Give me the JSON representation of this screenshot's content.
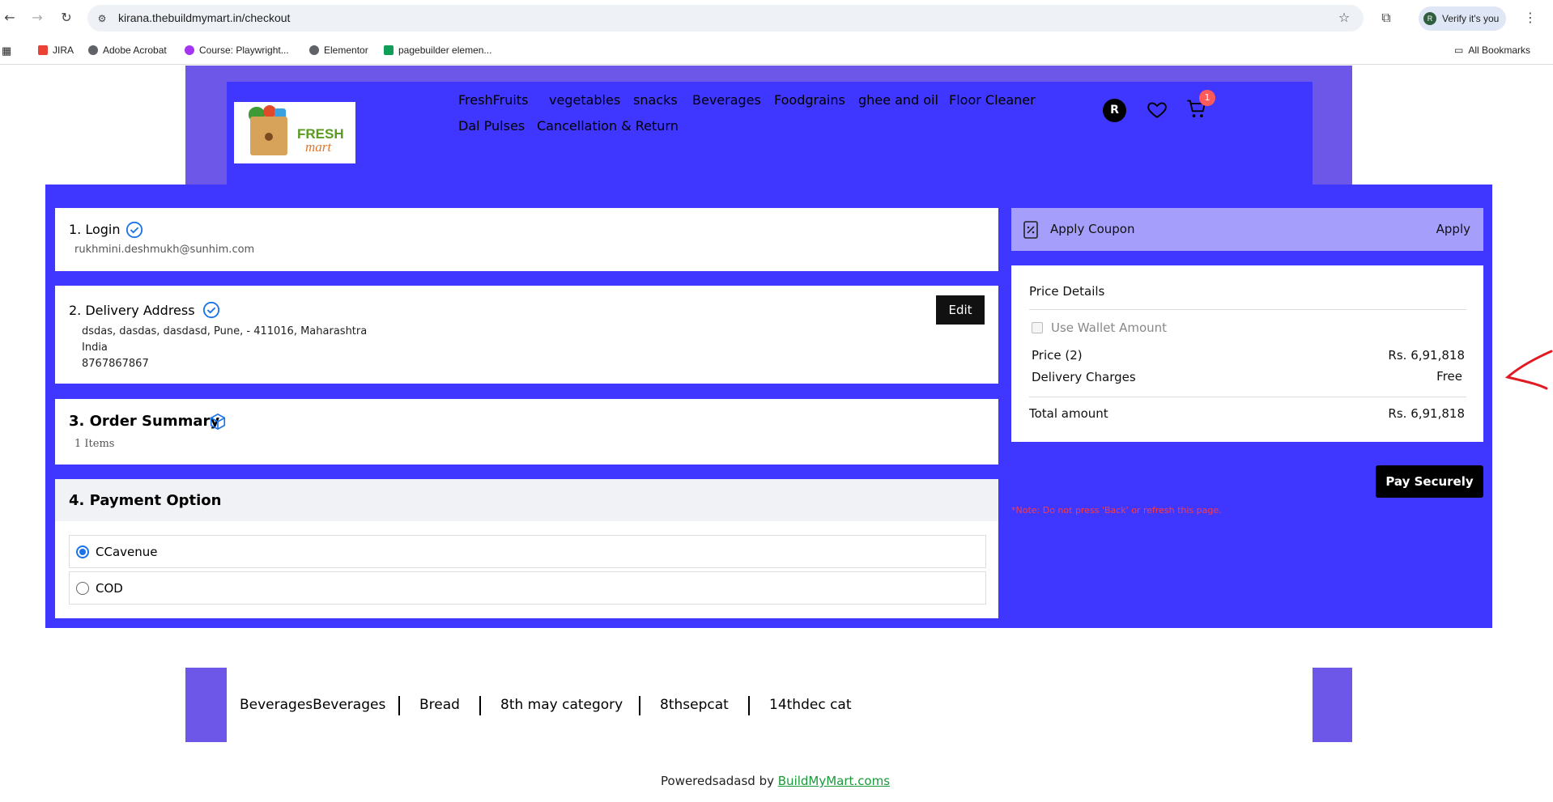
{
  "browser": {
    "url": "kirana.thebuildmymart.in/checkout",
    "profile_initial": "R",
    "verify_label": "Verify it's you",
    "bookmarks": [
      "JIRA",
      "Adobe Acrobat",
      "Course: Playwright...",
      "Elementor",
      "pagebuilder elemen..."
    ],
    "all_bookmarks": "All Bookmarks"
  },
  "header": {
    "logo_word1": "FRESH",
    "logo_word2": "mart",
    "menu": [
      "FreshFruits",
      "vegetables",
      "snacks",
      "Beverages",
      "Foodgrains",
      "ghee and oil",
      "Floor Cleaner",
      "Dal Pulses",
      "Cancellation & Return"
    ],
    "account_initial": "R",
    "cart_count": "1"
  },
  "checkout": {
    "login": {
      "title": "1. Login",
      "email": "rukhmini.deshmukh@sunhim.com"
    },
    "delivery": {
      "title": "2. Delivery Address",
      "line1": "dsdas, dasdas, dasdasd, Pune, - 411016, Maharashtra",
      "line2": "India",
      "phone": "8767867867",
      "edit_label": "Edit"
    },
    "summary": {
      "title": "3. Order Summary",
      "items": "1 Items"
    },
    "payment": {
      "title": "4. Payment Option",
      "options": [
        {
          "label": "CCavenue",
          "selected": true
        },
        {
          "label": "COD",
          "selected": false
        }
      ]
    }
  },
  "sidebar": {
    "coupon_label": "Apply Coupon",
    "apply_label": "Apply",
    "price_details_title": "Price Details",
    "wallet_label": "Use Wallet Amount",
    "price_label": "Price (2)",
    "price_value": "Rs. 6,91,818",
    "delivery_label": "Delivery Charges",
    "delivery_value": "Free",
    "total_label": "Total amount",
    "total_value": "Rs. 6,91,818",
    "pay_label": "Pay Securely",
    "note": "*Note: Do not press 'Back' or refresh this page."
  },
  "footer": {
    "links": [
      "BeveragesBeverages",
      "Bread",
      "8th may category",
      "8thsepcat",
      "14thdec cat"
    ],
    "powered_prefix": "Poweredsadasd by ",
    "powered_link": "BuildMyMart.coms"
  },
  "colors": {
    "primary": "#3f37ff",
    "header_frame": "#6c57e8",
    "coupon_bg": "#a59ffb",
    "note": "#ff3b3b",
    "check_blue": "#1a73e8",
    "annotation_red": "#e01b24"
  }
}
